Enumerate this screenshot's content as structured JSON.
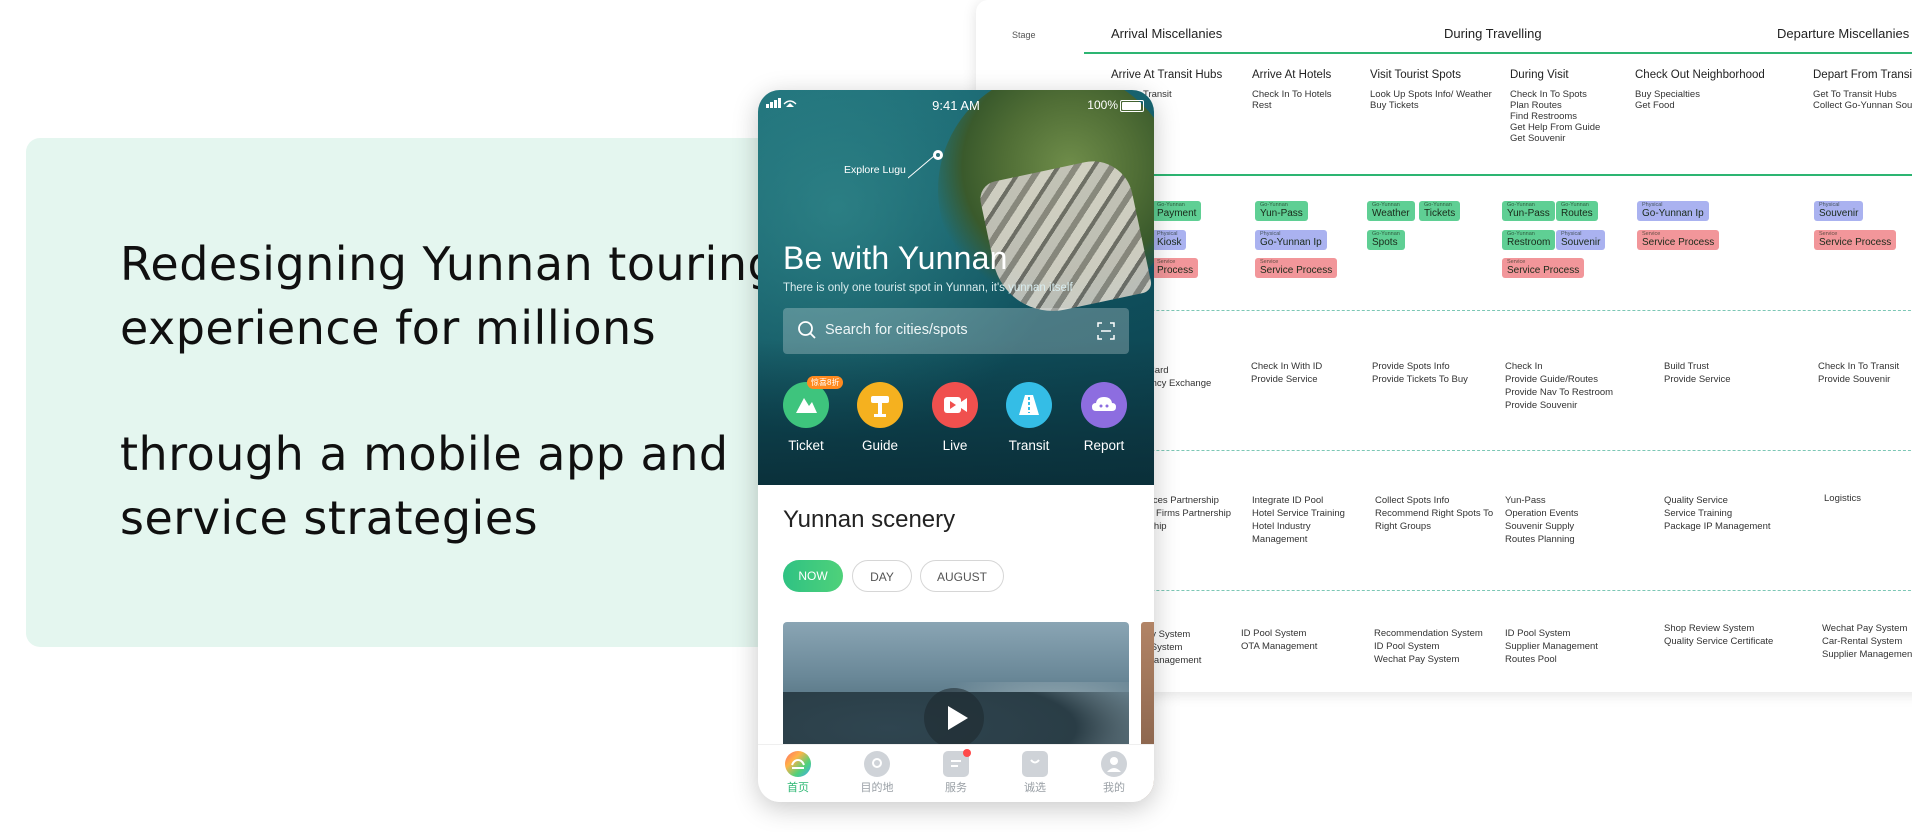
{
  "headline": {
    "line1": "Redesigning Yunnan touring",
    "line2": "experience for millions",
    "line3": "through a mobile app and",
    "line4": "service strategies"
  },
  "colors": {
    "accent_green": "#2fc283",
    "card_bg": "#e4f6ef",
    "chip_green": "#5fcf94",
    "chip_blue": "#aab2f0",
    "chip_red": "#f2969a"
  },
  "blueprint": {
    "stage_label": "Stage",
    "stages": [
      "Arrival Miscellanies",
      "During Travelling",
      "Departure Miscellanies"
    ],
    "columns": [
      {
        "title": "Arrive At Transit Hubs",
        "items": [
          "Transit"
        ]
      },
      {
        "title": "Arrive At Hotels",
        "items": [
          "Check In To Hotels",
          "Rest"
        ]
      },
      {
        "title": "Visit Tourist Spots",
        "items": [
          "Look Up Spots Info/ Weather",
          "Buy Tickets"
        ]
      },
      {
        "title": "During Visit",
        "items": [
          "Check In To Spots",
          "Plan Routes",
          "Find Restrooms",
          "Get Help From Guide",
          "Get Souvenir"
        ]
      },
      {
        "title": "Check Out Neighborhood",
        "items": [
          "Buy Specialties",
          "Get Food"
        ]
      },
      {
        "title": "Depart From Transit",
        "items": [
          "Get To Transit Hubs",
          "Collect Go-Yunnan Souvenir"
        ]
      }
    ],
    "chips": {
      "go_yunnan": "Go-Yunnan",
      "physical": "Physical",
      "service": "Service",
      "payment": "Payment",
      "kiosk": "Kiosk",
      "process": "Process",
      "yun_pass": "Yun-Pass",
      "go_yunnan_ip": "Go-Yunnan Ip",
      "service_process": "Service Process",
      "weather": "Weather",
      "tickets": "Tickets",
      "spots": "Spots",
      "routes": "Routes",
      "restroom": "Restroom",
      "souvenir": "Souvenir"
    },
    "frontstage": [
      {
        "lines": [
          "n Card",
          "rrency Exchange"
        ]
      },
      {
        "lines": [
          "Check In With ID",
          "Provide Service"
        ]
      },
      {
        "lines": [
          "Provide Spots Info",
          "Provide Tickets To Buy"
        ]
      },
      {
        "lines": [
          "Check In",
          "Provide Guide/Routes",
          "Provide Nav To Restroom",
          "Provide Souvenir"
        ]
      },
      {
        "lines": [
          "Build Trust",
          "Provide Service"
        ]
      },
      {
        "lines": [
          "Check In To Transit",
          "Provide Souvenir"
        ]
      }
    ],
    "backstage": [
      {
        "lines": [
          "vices Partnership",
          "al Firms Partnership",
          "rship"
        ]
      },
      {
        "lines": [
          "Integrate ID Pool",
          "Hotel Service Training",
          "Hotel Industry",
          "Management"
        ]
      },
      {
        "lines": [
          "Collect Spots Info",
          "Recommend Right Spots To",
          "Right Groups"
        ]
      },
      {
        "lines": [
          "Yun-Pass",
          "Operation Events",
          "Souvenir Supply",
          "Routes Planning"
        ]
      },
      {
        "lines": [
          "Quality Service",
          "Service Training",
          "Package IP Management"
        ]
      },
      {
        "lines": [
          "Logistics"
        ]
      }
    ],
    "support": [
      {
        "lines": [
          "ay System",
          "l System",
          "Management"
        ]
      },
      {
        "lines": [
          "ID Pool System",
          "OTA Management"
        ]
      },
      {
        "lines": [
          "Recommendation System",
          "ID Pool System",
          "Wechat Pay System"
        ]
      },
      {
        "lines": [
          "ID Pool System",
          "Supplier Management",
          "Routes Pool"
        ]
      },
      {
        "lines": [
          "Shop Review System",
          "Quality Service Certificate"
        ]
      },
      {
        "lines": [
          "Wechat Pay System",
          "Car-Rental System",
          "Supplier Management"
        ]
      }
    ]
  },
  "phone": {
    "status": {
      "time": "9:41 AM",
      "battery": "100%"
    },
    "explore_label": "Explore Lugu",
    "hero_title": "Be with Yunnan",
    "hero_subtitle": "There is only one tourist spot in Yunnan, it's yunnan itself",
    "search_placeholder": "Search for cities/spots",
    "quick_actions": [
      {
        "label": "Ticket",
        "badge": "惊喜8折",
        "color": "#3ec47d",
        "icon": "mountain-icon"
      },
      {
        "label": "Guide",
        "color": "#f5b11f",
        "icon": "guide-icon"
      },
      {
        "label": "Live",
        "color": "#f0504e",
        "icon": "video-icon"
      },
      {
        "label": "Transit",
        "color": "#34bde6",
        "icon": "road-icon"
      },
      {
        "label": "Report",
        "color": "#8d6de0",
        "icon": "cloud-icon"
      }
    ],
    "section_title": "Yunnan scenery",
    "filters": [
      {
        "label": "NOW",
        "active": true
      },
      {
        "label": "DAY",
        "active": false
      },
      {
        "label": "AUGUST",
        "active": false
      }
    ],
    "tabs": [
      {
        "label": "首页",
        "active": true,
        "icon": "home-icon"
      },
      {
        "label": "目的地",
        "active": false,
        "icon": "destination-icon"
      },
      {
        "label": "服务",
        "active": false,
        "icon": "service-icon"
      },
      {
        "label": "诚选",
        "active": false,
        "icon": "shop-icon"
      },
      {
        "label": "我的",
        "active": false,
        "icon": "profile-icon"
      }
    ]
  }
}
